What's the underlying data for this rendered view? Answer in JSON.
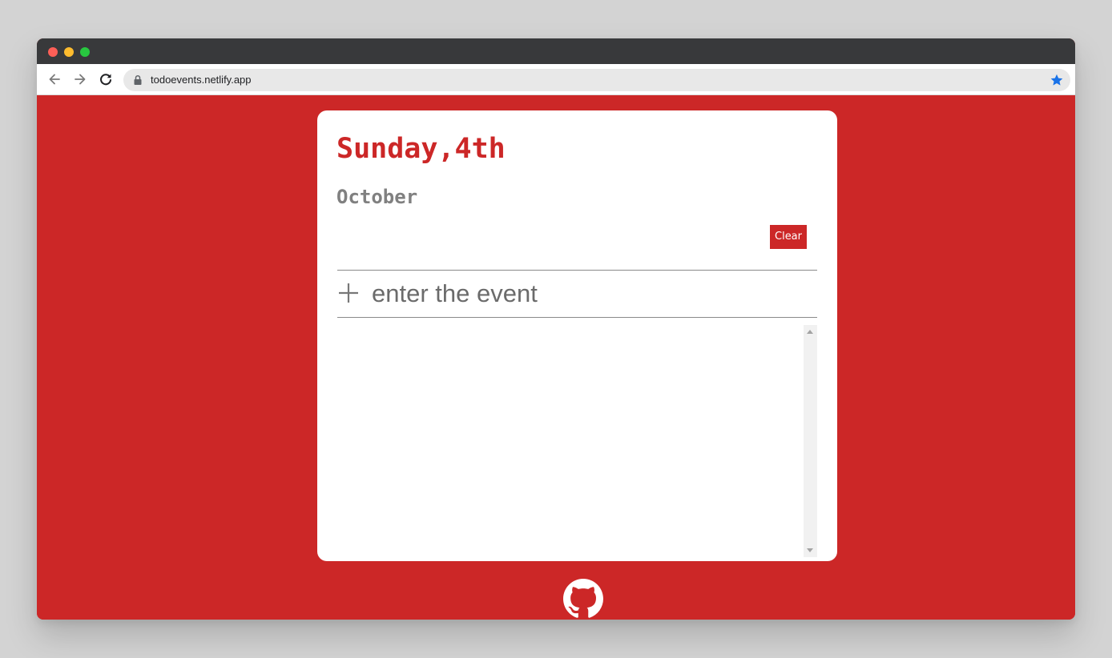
{
  "browser": {
    "url": "todoevents.netlify.app"
  },
  "app": {
    "day_title": "Sunday,4th",
    "month": "October",
    "clear_label": "Clear",
    "event_placeholder": "enter the event",
    "event_value": "",
    "events": []
  },
  "colors": {
    "accent": "#cc2727",
    "month_text": "#808080",
    "page_background": "#cc2727"
  },
  "icons": {
    "add": "plus-icon",
    "footer": "github-icon"
  }
}
